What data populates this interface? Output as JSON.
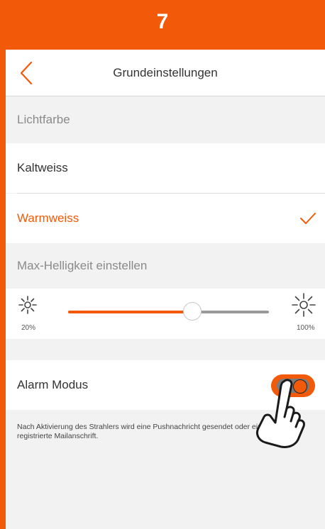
{
  "step": {
    "number": "7",
    "color": "#f25a0a"
  },
  "nav": {
    "back_icon": "chevron-left-icon",
    "title": "Grundeinstellungen"
  },
  "light_color": {
    "header": "Lichtfarbe",
    "options": [
      {
        "label": "Kaltweiss",
        "selected": false
      },
      {
        "label": "Warmweiss",
        "selected": true
      }
    ],
    "selected_icon": "checkmark-icon"
  },
  "brightness": {
    "header": "Max-Helligkeit einstellen",
    "min_label": "20%",
    "max_label": "100%",
    "value_fraction": 0.62,
    "min_icon": "sun-small-icon",
    "max_icon": "sun-large-icon"
  },
  "alarm": {
    "label": "Alarm Modus",
    "enabled": true,
    "info": "Nach Aktivierung des Strahlers wird eine Pushnachricht gesendet oder eine Mail an die registrierte Mailanschrift."
  },
  "colors": {
    "accent": "#f25a0a",
    "background": "#f2f2f2",
    "text": "#333333",
    "muted": "#8a8a8a"
  }
}
